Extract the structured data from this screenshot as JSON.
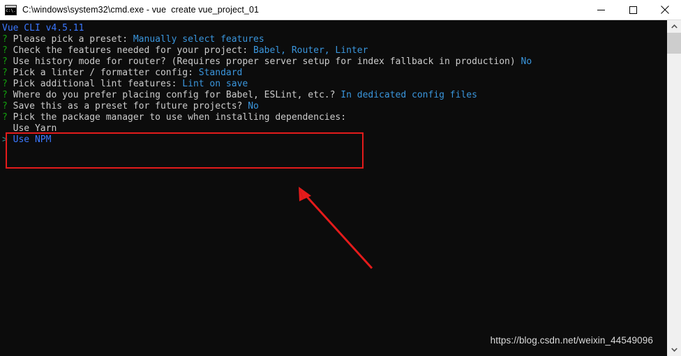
{
  "window": {
    "title": "C:\\windows\\system32\\cmd.exe - vue  create vue_project_01",
    "icon": "cmd-console-icon",
    "background_color": "#0c0c0c",
    "titlebar_color": "#ffffff"
  },
  "controls": {
    "minimize_label": "Minimize",
    "maximize_label": "Maximize",
    "close_label": "Close"
  },
  "terminal": {
    "lines": [
      [
        {
          "text": "Vue CLI v4.5.11",
          "color": "blue"
        }
      ],
      [
        {
          "text": "? ",
          "color": "green"
        },
        {
          "text": "Please pick a preset: ",
          "color": "white"
        },
        {
          "text": "Manually select features",
          "color": "cyan"
        }
      ],
      [
        {
          "text": "? ",
          "color": "green"
        },
        {
          "text": "Check the features needed for your project: ",
          "color": "white"
        },
        {
          "text": "Babel, Router, Linter",
          "color": "cyan"
        }
      ],
      [
        {
          "text": "? ",
          "color": "green"
        },
        {
          "text": "Use history mode for router? (Requires proper server setup for index fallback in production) ",
          "color": "white"
        },
        {
          "text": "No",
          "color": "cyan"
        }
      ],
      [
        {
          "text": "? ",
          "color": "green"
        },
        {
          "text": "Pick a linter / formatter config: ",
          "color": "white"
        },
        {
          "text": "Standard",
          "color": "cyan"
        }
      ],
      [
        {
          "text": "? ",
          "color": "green"
        },
        {
          "text": "Pick additional lint features: ",
          "color": "white"
        },
        {
          "text": "Lint on save",
          "color": "cyan"
        }
      ],
      [
        {
          "text": "? ",
          "color": "green"
        },
        {
          "text": "Where do you prefer placing config for Babel, ESLint, etc.? ",
          "color": "white"
        },
        {
          "text": "In dedicated config files",
          "color": "cyan"
        }
      ],
      [
        {
          "text": "? ",
          "color": "green"
        },
        {
          "text": "Save this as a preset for future projects? ",
          "color": "white"
        },
        {
          "text": "No",
          "color": "cyan"
        }
      ],
      [
        {
          "text": "? ",
          "color": "green"
        },
        {
          "text": "Pick the package manager to use when installing dependencies:",
          "color": "white"
        }
      ],
      [
        {
          "text": "  Use Yarn",
          "color": "white"
        }
      ],
      [
        {
          "text": ">",
          "color": "teal"
        },
        {
          "text": " ",
          "color": "white"
        },
        {
          "text": "Use NPM",
          "color": "blue"
        }
      ]
    ]
  },
  "annotations": {
    "highlight_box": {
      "name": "package-manager-prompt-highlight",
      "color": "#e41b1b"
    },
    "arrow": {
      "name": "pointer-arrow",
      "color": "#e41b1b"
    }
  },
  "watermark": {
    "text": "https://blog.csdn.net/weixin_44549096",
    "color": "#dcdcdc"
  },
  "scrollbar": {
    "up_arrow": "chevron-up-icon",
    "down_arrow": "chevron-down-icon",
    "track_color": "#f0f0f0",
    "thumb_color": "#cdcdcd"
  }
}
